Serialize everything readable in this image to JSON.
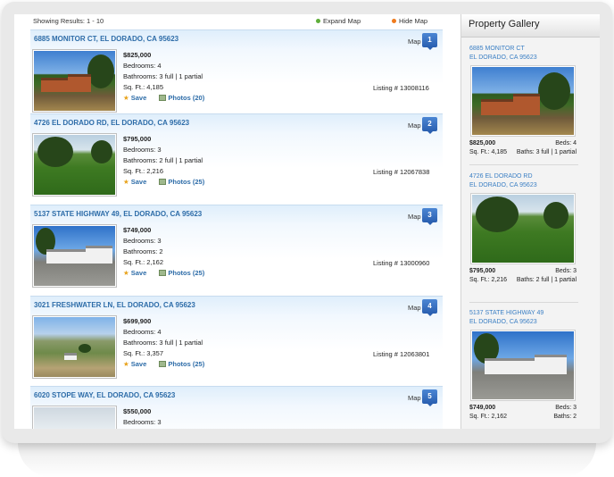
{
  "header": {
    "results_text": "Showing Results: 1 - 10",
    "expand_map": "Expand Map",
    "hide_map": "Hide Map"
  },
  "listings": [
    {
      "address": "6885 MONITOR CT, EL DORADO, CA 95623",
      "map": "Map",
      "pin": "1",
      "price": "$825,000",
      "bedrooms": "Bedrooms: 4",
      "bathrooms": "Bathrooms: 3 full | 1 partial",
      "sqft": "Sq. Ft.: 4,185",
      "save": "Save",
      "photos": "Photos (20)",
      "listing_number": "Listing # 13008116"
    },
    {
      "address": "4726 EL DORADO RD, EL DORADO, CA 95623",
      "map": "Map",
      "pin": "2",
      "price": "$795,000",
      "bedrooms": "Bedrooms: 3",
      "bathrooms": "Bathrooms: 2 full | 1 partial",
      "sqft": "Sq. Ft.: 2,216",
      "save": "Save",
      "photos": "Photos (25)",
      "listing_number": "Listing # 12067838"
    },
    {
      "address": "5137 STATE HIGHWAY 49, EL DORADO, CA 95623",
      "map": "Map",
      "pin": "3",
      "price": "$749,000",
      "bedrooms": "Bedrooms: 3",
      "bathrooms": "Bathrooms: 2",
      "sqft": "Sq. Ft.: 2,162",
      "save": "Save",
      "photos": "Photos (25)",
      "listing_number": "Listing # 13000960"
    },
    {
      "address": "3021 FRESHWATER LN, EL DORADO, CA 95623",
      "map": "Map",
      "pin": "4",
      "price": "$699,900",
      "bedrooms": "Bedrooms: 4",
      "bathrooms": "Bathrooms: 3 full | 1 partial",
      "sqft": "Sq. Ft.: 3,357",
      "save": "Save",
      "photos": "Photos (25)",
      "listing_number": "Listing # 12063801"
    },
    {
      "address": "6020 STOPE WAY, EL DORADO, CA 95623",
      "map": "Map",
      "pin": "5",
      "price": "$550,000",
      "bedrooms": "Bedrooms: 3"
    }
  ],
  "gallery": {
    "title": "Property Gallery",
    "items": [
      {
        "line1": "6885 MONITOR CT",
        "line2": "EL DORADO, CA 95623",
        "price": "$825,000",
        "beds": "Beds: 4",
        "sqft": "Sq. Ft.: 4,185",
        "baths": "Baths: 3 full | 1 partial"
      },
      {
        "line1": "4726 EL DORADO RD",
        "line2": "EL DORADO, CA 95623",
        "price": "$795,000",
        "beds": "Beds: 3",
        "sqft": "Sq. Ft.: 2,216",
        "baths": "Baths: 2 full | 1 partial"
      },
      {
        "line1": "5137 STATE HIGHWAY 49",
        "line2": "EL DORADO, CA 95623",
        "price": "$749,000",
        "beds": "Beds: 3",
        "sqft": "Sq. Ft.: 2,162",
        "baths": "Baths: 2"
      }
    ]
  }
}
